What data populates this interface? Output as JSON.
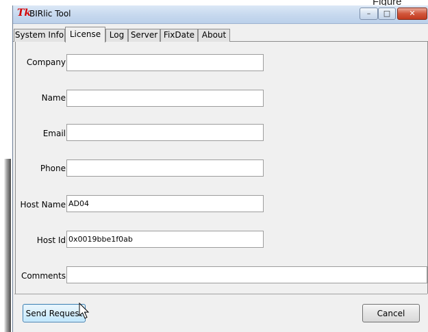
{
  "background": {
    "figure_label": "Figure"
  },
  "window": {
    "title": "BIRlic Tool",
    "app_icon": "Tk",
    "controls": {
      "minimize": "–",
      "maximize": "□",
      "close": "✕"
    }
  },
  "tabs": [
    {
      "label": "System Info",
      "active": false
    },
    {
      "label": "License",
      "active": true
    },
    {
      "label": "Log",
      "active": false
    },
    {
      "label": "Server",
      "active": false
    },
    {
      "label": "FixDate",
      "active": false
    },
    {
      "label": "About",
      "active": false
    }
  ],
  "form": {
    "company": {
      "label": "Company",
      "value": ""
    },
    "name": {
      "label": "Name",
      "value": ""
    },
    "email": {
      "label": "Email",
      "value": ""
    },
    "phone": {
      "label": "Phone",
      "value": ""
    },
    "host_name": {
      "label": "Host Name",
      "value": "AD04"
    },
    "host_id": {
      "label": "Host Id",
      "value": "0x0019bbe1f0ab"
    },
    "comments": {
      "label": "Comments",
      "value": ""
    }
  },
  "buttons": {
    "send_request": "Send Request",
    "cancel": "Cancel"
  },
  "colors": {
    "close_button": "#c23a1f",
    "focused_button": "#3c7fb1",
    "app_icon": "#d40000"
  },
  "icons": {
    "app": "tk-feather-icon",
    "cursor": "mouse-pointer-icon"
  }
}
